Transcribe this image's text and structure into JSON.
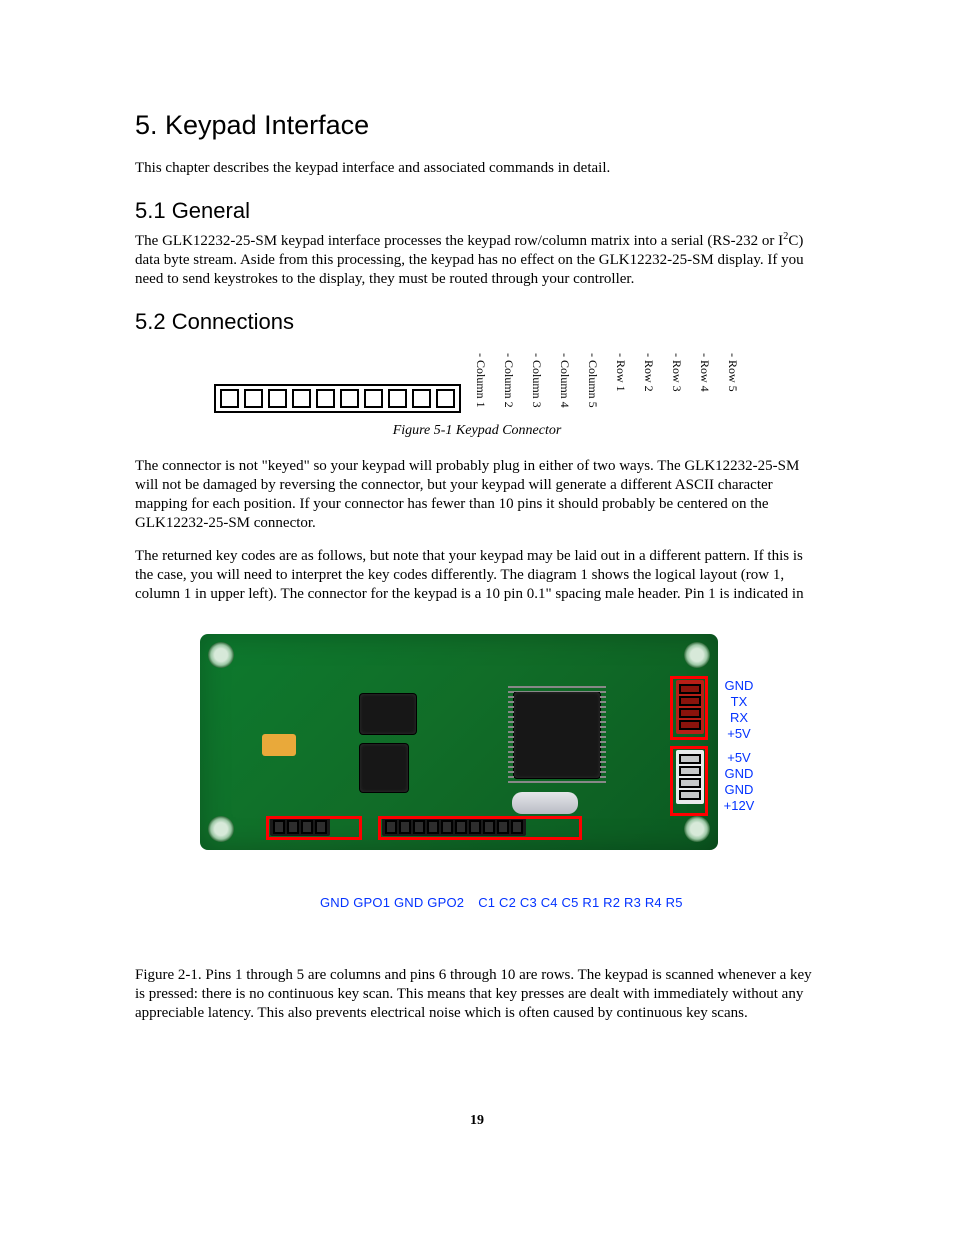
{
  "headings": {
    "h1": "5. Keypad Interface",
    "h2a": "5.1 General",
    "h2b": "5.2 Connections"
  },
  "paragraphs": {
    "intro": "This chapter describes the keypad interface and associated commands in detail.",
    "general_a": "The GLK12232-25-SM keypad interface processes the keypad row/column matrix into a serial (RS-232 or I",
    "general_sup": "2",
    "general_b": "C) data byte stream. Aside from this processing, the keypad has no effect on the GLK12232-25-SM display. If you need to send keystrokes to the display, they must be routed through your controller.",
    "conn_p1": "The connector is not \"keyed\" so your keypad will probably plug in either of two ways. The GLK12232-25-SM will not be damaged by reversing the connector, but your keypad will generate a different ASCII character mapping for each position. If your connector has fewer than 10 pins it should probably be centered on the GLK12232-25-SM connector.",
    "conn_p2": "The returned key codes are as follows, but note that your keypad may be laid out in a different pattern. If this is the case, you will need to interpret the key codes differently. The diagram 1 shows the logical layout (row 1, column 1 in upper left). The connector for the keypad is a 10 pin 0.1\" spacing male header. Pin 1 is indicated in",
    "after_pcb": "Figure 2-1. Pins 1 through 5 are columns and pins 6 through 10 are rows. The keypad is scanned whenever a key is pressed: there is no continuous key scan. This means that key presses are dealt with immediately without any appreciable latency. This also prevents electrical noise which is often caused by continuous key scans."
  },
  "figure51": {
    "caption": "Figure 5-1 Keypad Connector",
    "labels": [
      "- Column 1",
      "- Column 2",
      "- Column 3",
      "- Column 4",
      "- Column 5",
      "- Row 1",
      "- Row 2",
      "- Row 3",
      "- Row 4",
      "- Row 5"
    ]
  },
  "pcb": {
    "side": [
      "GND",
      "TX",
      "RX",
      "+5V",
      "+5V",
      "GND",
      "GND",
      "+12V"
    ],
    "bottom_left": "GND GPO1 GND GPO2",
    "bottom_right": "C1 C2 C3 C4 C5 R1 R2 R3 R4 R5"
  },
  "pagenum": "19"
}
